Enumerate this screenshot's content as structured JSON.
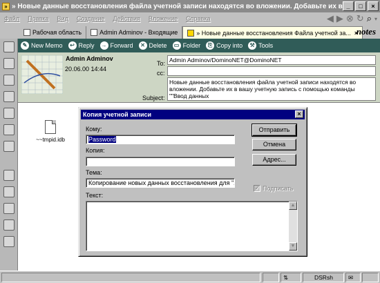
{
  "window": {
    "title": "» Новые данные восстановления файла учетной записи находятся во вложении. Добавьте их в вашу учетн...",
    "controls": [
      "_",
      "□",
      "×"
    ]
  },
  "menu": [
    "Файл",
    "Правка",
    "Вид",
    "Создание",
    "Действия",
    "Вложение",
    "Справка"
  ],
  "tabs": [
    {
      "label": "Рабочая область"
    },
    {
      "label": "Admin Adminov - Входящие"
    },
    {
      "label": "» Новые данные восстановления Файла учетной за..."
    }
  ],
  "logo": "notes",
  "actions": [
    {
      "label": "New Memo",
      "icon": "new-memo-icon",
      "glyph": "✎"
    },
    {
      "label": "Reply",
      "icon": "reply-icon",
      "glyph": "↩"
    },
    {
      "label": "Forward",
      "icon": "forward-icon",
      "glyph": "→"
    },
    {
      "label": "Delete",
      "icon": "delete-icon",
      "glyph": "✕"
    },
    {
      "label": "Folder",
      "icon": "folder-icon",
      "glyph": "▭"
    },
    {
      "label": "Copy into",
      "icon": "copy-into-icon",
      "glyph": "⎘"
    },
    {
      "label": "Tools",
      "icon": "tools-icon",
      "glyph": "⚒"
    }
  ],
  "memo": {
    "sender": "Admin Adminov",
    "date": "20.06.00 14:44",
    "to_label": "To:",
    "to_value": "Admin Adminov/DominoNET@DominoNET",
    "cc_label": "cc:",
    "cc_value": "",
    "subject_label": "Subject:",
    "subject_value": "Новые данные восстановления файла учетной записи находятся во вложении. Добавьте их в вашу учетную запись с помощью команды \"\"Ввод данных"
  },
  "attachment": {
    "name": "~~tmpid.idb"
  },
  "dialog": {
    "title": "Копия учетной записи",
    "close": "×",
    "to_label": "Кому:",
    "to_value": "Password",
    "copy_label": "Копия:",
    "copy_value": "",
    "subject_label": "Тема:",
    "subject_value": "Копирование новых данных восстановления для ''Adm",
    "text_label": "Текст:",
    "send_button": "Отправить",
    "cancel_button": "Отмена",
    "address_button": "Адрес...",
    "sign_label": "Подписать",
    "sign_checked": true
  },
  "status": {
    "location": "DSRsh"
  },
  "colors": {
    "action_bar": "#305c58",
    "dialog_title": "#000080",
    "header_bg": "#cdd6c4"
  }
}
